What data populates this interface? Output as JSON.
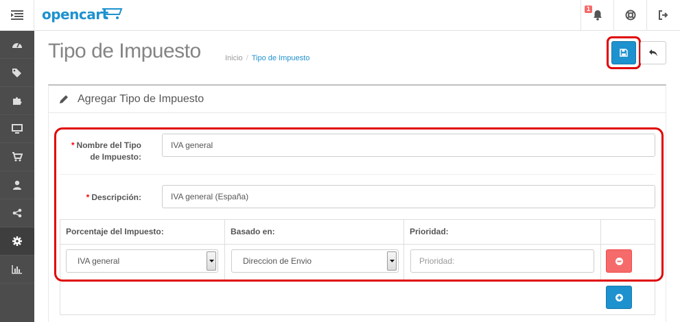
{
  "header": {
    "logo_text": "opencart",
    "notification_count": "1",
    "icons": [
      "menu-icon",
      "bell-icon",
      "lifebuoy-icon",
      "sign-out-icon"
    ]
  },
  "sidebar": {
    "items": [
      {
        "icon": "dashboard-icon"
      },
      {
        "icon": "tags-icon"
      },
      {
        "icon": "puzzle-icon"
      },
      {
        "icon": "desktop-icon"
      },
      {
        "icon": "shopping-cart-icon"
      },
      {
        "icon": "user-icon"
      },
      {
        "icon": "share-icon"
      },
      {
        "icon": "cog-icon",
        "active": true
      },
      {
        "icon": "bar-chart-icon"
      }
    ]
  },
  "page": {
    "title": "Tipo de Impuesto",
    "breadcrumb": {
      "home": "Inicio",
      "separator": "/",
      "current": "Tipo de Impuesto"
    }
  },
  "panel": {
    "title": "Agregar Tipo de Impuesto"
  },
  "form": {
    "required_mark": "*",
    "name_label_line1": "Nombre del Tipo",
    "name_label_line2": "de Impuesto:",
    "name_value": "IVA general",
    "description_label": "Descripción:",
    "description_value": "IVA general (España)"
  },
  "rates_table": {
    "headers": {
      "rate": "Porcentaje del Impuesto:",
      "based": "Basado en:",
      "priority": "Prioridad:"
    },
    "row": {
      "rate_selected": "IVA general",
      "based_selected": "Direccion de Envio",
      "priority_placeholder": "Prioridad:"
    }
  },
  "colors": {
    "primary": "#1e91cf",
    "danger": "#f56b6b",
    "sidebar": "#4c4c4c",
    "highlight": "#e00000"
  }
}
